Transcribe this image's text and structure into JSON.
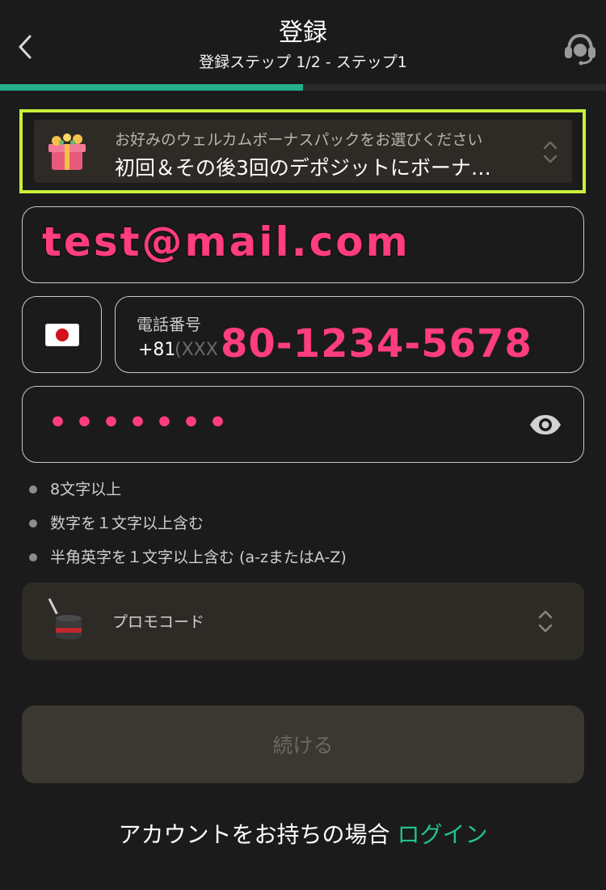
{
  "header": {
    "title": "登録",
    "subtitle": "登録ステップ 1/2 - ステップ1",
    "progress_fraction": 0.5,
    "back_icon": "chevron-left-icon",
    "support_icon": "headset-icon"
  },
  "bonus": {
    "label": "お好みのウェルカムボーナスパックをお選びください",
    "selected": "初回＆その後3回のデポジットにボーナ…",
    "icon": "gift-box-icon"
  },
  "email": {
    "value": "test@mail.com"
  },
  "phone": {
    "label": "電話番号",
    "prefix": "+81",
    "placeholder": "(XXX",
    "value": "80-1234-5678",
    "country_flag": "japan-flag-icon"
  },
  "password": {
    "value": "•••••••",
    "icon": "eye-icon"
  },
  "rules": [
    "8文字以上",
    "数字を１文字以上含む",
    "半角英字を１文字以上含む (a-zまたはA-Z)"
  ],
  "promo": {
    "label": "プロモコード",
    "icon": "magic-hat-icon"
  },
  "continue_label": "続ける",
  "login": {
    "prompt": "アカウントをお持ちの場合",
    "link": "ログイン"
  },
  "colors": {
    "accent_green": "#23b08a",
    "highlight_frame": "#c8f03a",
    "annotation_pink": "#ff3d7f",
    "background": "#1b1b1b"
  }
}
